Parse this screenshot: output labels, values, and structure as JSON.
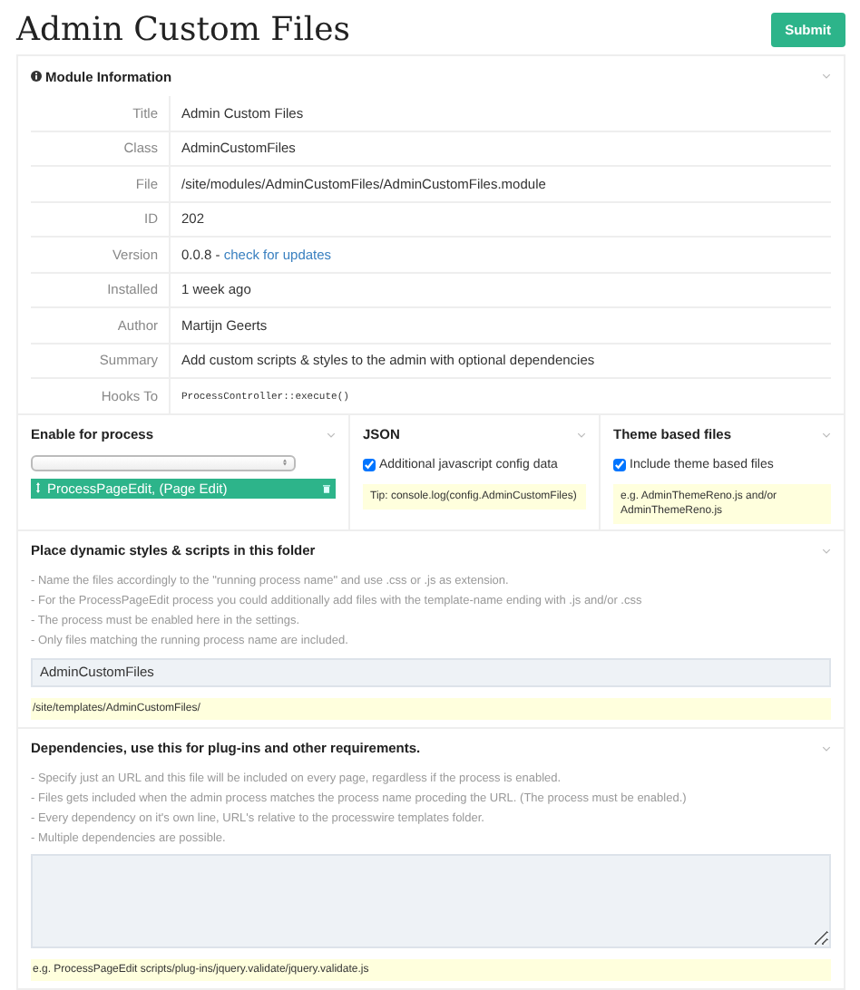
{
  "page": {
    "title": "Admin Custom Files",
    "submit": "Submit"
  },
  "module_info": {
    "heading": "Module Information",
    "rows": [
      {
        "label": "Title",
        "kind": "text",
        "value": "Admin Custom Files"
      },
      {
        "label": "Class",
        "kind": "text",
        "value": "AdminCustomFiles"
      },
      {
        "label": "File",
        "kind": "text",
        "value": "/site/modules/AdminCustomFiles/AdminCustomFiles.module"
      },
      {
        "label": "ID",
        "kind": "text",
        "value": "202"
      },
      {
        "label": "Version",
        "kind": "link",
        "value": "0.0.8 -",
        "link": "check for updates"
      },
      {
        "label": "Installed",
        "kind": "text",
        "value": "1 week ago"
      },
      {
        "label": "Author",
        "kind": "text",
        "value": "Martijn Geerts"
      },
      {
        "label": "Summary",
        "kind": "text",
        "value": "Add custom scripts & styles to the admin with optional dependencies"
      },
      {
        "label": "Hooks To",
        "kind": "code",
        "value": "ProcessController::execute()"
      }
    ]
  },
  "enable_for_process": {
    "heading": "Enable for process",
    "items": [
      "ProcessPageEdit, (Page Edit)"
    ]
  },
  "json": {
    "heading": "JSON",
    "checkbox": {
      "label": "Additional javascript config data",
      "checked": true
    },
    "note": "Tip: console.log(config.AdminCustomFiles)"
  },
  "theme_files": {
    "heading": "Theme based files",
    "checkbox": {
      "label": "Include theme based files",
      "checked": true
    },
    "note": "e.g. AdminThemeReno.js and/or AdminThemeReno.js"
  },
  "folder": {
    "heading": "Place dynamic styles & scripts in this folder",
    "description": [
      "- Name the files accordingly to the \"running process name\" and use .css or .js as extension.",
      "- For the ProcessPageEdit process you could additionally add files with the template-name ending with .js and/or .css",
      "- The process must be enabled here in the settings.",
      "- Only files matching the running process name are included."
    ],
    "value": "AdminCustomFiles",
    "note": "/site/templates/AdminCustomFiles/"
  },
  "dependencies": {
    "heading": "Dependencies, use this for plug-ins and other requirements.",
    "description": [
      "- Specify just an URL and this file will be included on every page, regardless if the process is enabled.",
      "- Files gets included when the admin process matches the process name proceding the URL. (The process must be enabled.)",
      "- Every dependency on it's own line, URL's relative to the processwire templates folder.",
      "- Multiple dependencies are possible."
    ],
    "note": "e.g. ProcessPageEdit scripts/plug-ins/jquery.validate/jquery.validate.js"
  }
}
